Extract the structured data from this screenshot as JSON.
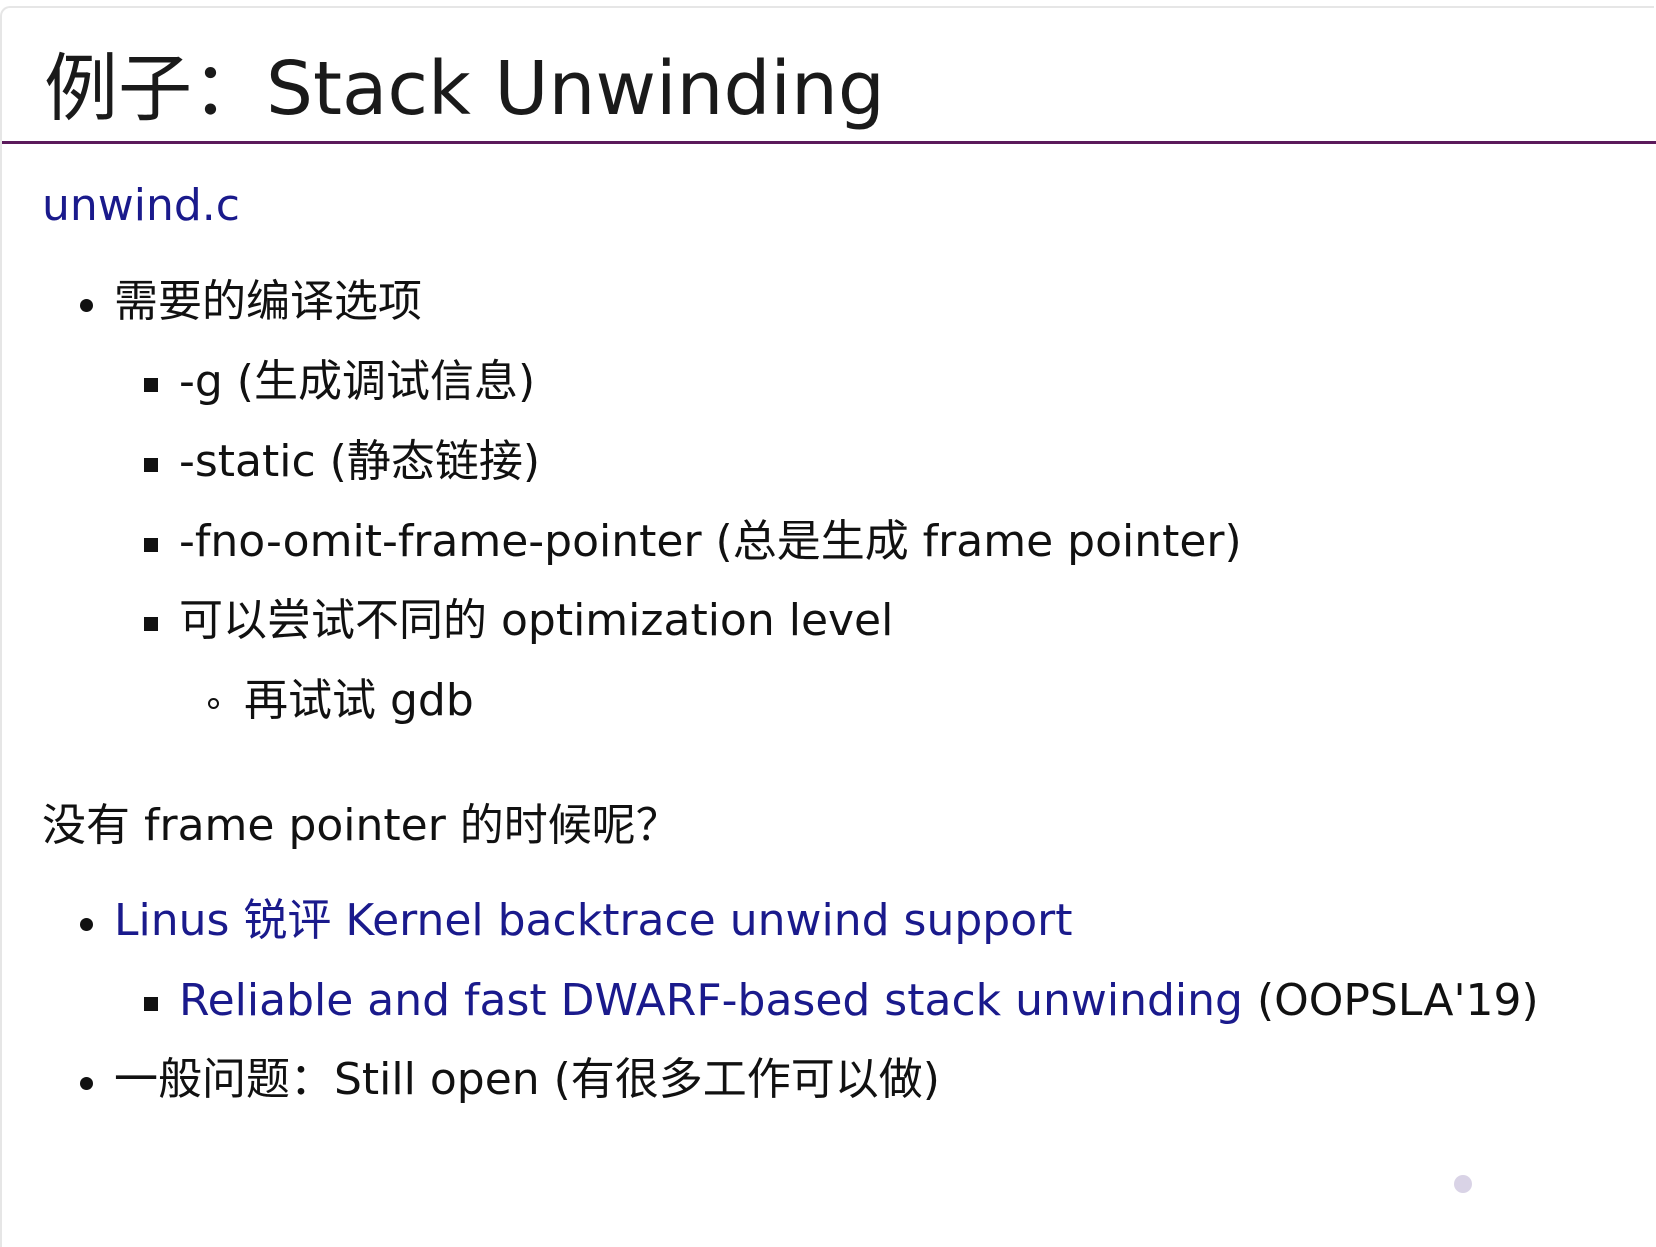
{
  "slide": {
    "title": "例子：Stack Unwinding",
    "source_link": "unwind.c",
    "compile_section": {
      "heading": "需要的编译选项",
      "options": [
        "-g (生成调试信息)",
        "-static (静态链接)",
        "-fno-omit-frame-pointer (总是生成 frame pointer)",
        "可以尝试不同的 optimization level"
      ],
      "sub_item": "再试试 gdb"
    },
    "question": "没有 frame pointer 的时候呢？",
    "references": {
      "linus_link": "Linus 锐评 Kernel backtrace unwind support",
      "paper_link": "Reliable and fast DWARF-based stack unwinding",
      "paper_venue": " (OOPSLA'19)",
      "general_item": "一般问题：Still open (有很多工作可以做)"
    }
  }
}
